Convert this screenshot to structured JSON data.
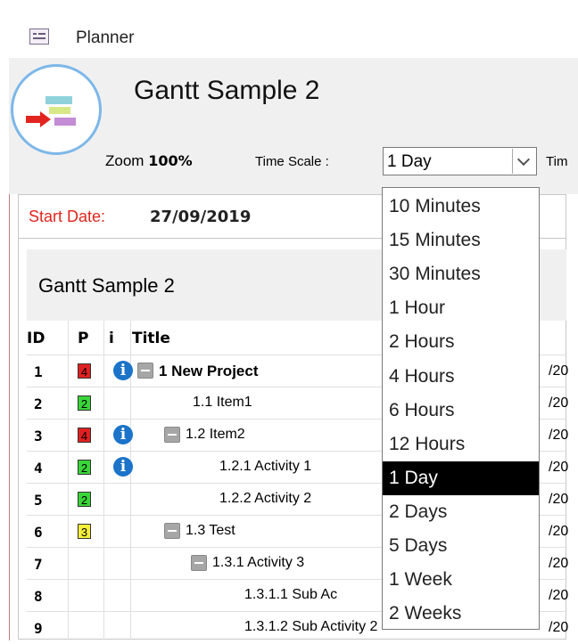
{
  "window": {
    "title": "Planner",
    "icon": "form-icon"
  },
  "header": {
    "form_title": "Gantt Sample 2",
    "zoom_label": "Zoom",
    "zoom_value": "100%",
    "time_scale_label": "Time Scale :",
    "time_scale_value": "1 Day",
    "next_label_fragment": "Tim"
  },
  "start": {
    "label": "Start Date:",
    "value": "27/09/2019"
  },
  "gantt": {
    "title": "Gantt Sample 2",
    "columns": {
      "id": "ID",
      "p": "P",
      "i": "i",
      "title": "Title"
    },
    "rows": [
      {
        "id": "1",
        "p": "4",
        "p_color": "#e02020",
        "info": "i",
        "expander": true,
        "title": "1 New Project",
        "bold": true,
        "date": "/20"
      },
      {
        "id": "2",
        "p": "2",
        "p_color": "#39d639",
        "info": "",
        "expander": false,
        "title": "1.1 Item1",
        "bold": false,
        "date": "/20"
      },
      {
        "id": "3",
        "p": "4",
        "p_color": "#e02020",
        "info": "i",
        "expander": true,
        "title": "1.2 Item2",
        "bold": false,
        "date": "/20"
      },
      {
        "id": "4",
        "p": "2",
        "p_color": "#39d639",
        "info": "i",
        "expander": false,
        "title": "1.2.1 Activity 1",
        "bold": false,
        "date": "/20"
      },
      {
        "id": "5",
        "p": "2",
        "p_color": "#39d639",
        "info": "",
        "expander": false,
        "title": "1.2.2 Activity 2",
        "bold": false,
        "date": "/20"
      },
      {
        "id": "6",
        "p": "3",
        "p_color": "#f5f03a",
        "info": "",
        "expander": true,
        "title": "1.3 Test",
        "bold": false,
        "date": "/20"
      },
      {
        "id": "7",
        "p": "",
        "p_color": "",
        "info": "",
        "expander": true,
        "title": "1.3.1 Activity 3",
        "bold": false,
        "date": "/20"
      },
      {
        "id": "8",
        "p": "",
        "p_color": "",
        "info": "",
        "expander": false,
        "title": "1.3.1.1 Sub Ac",
        "bold": false,
        "date": "/20"
      },
      {
        "id": "9",
        "p": "",
        "p_color": "",
        "info": "",
        "expander": false,
        "title": "1.3.1.2 Sub Activity 2",
        "bold": false,
        "date": "/20"
      }
    ]
  },
  "dropdown": {
    "options": [
      "10 Minutes",
      "15 Minutes",
      "30 Minutes",
      "1 Hour",
      "2 Hours",
      "4 Hours",
      "6 Hours",
      "12 Hours",
      "1 Day",
      "2 Days",
      "5 Days",
      "1 Week",
      "2 Weeks"
    ],
    "selected": "1 Day"
  }
}
